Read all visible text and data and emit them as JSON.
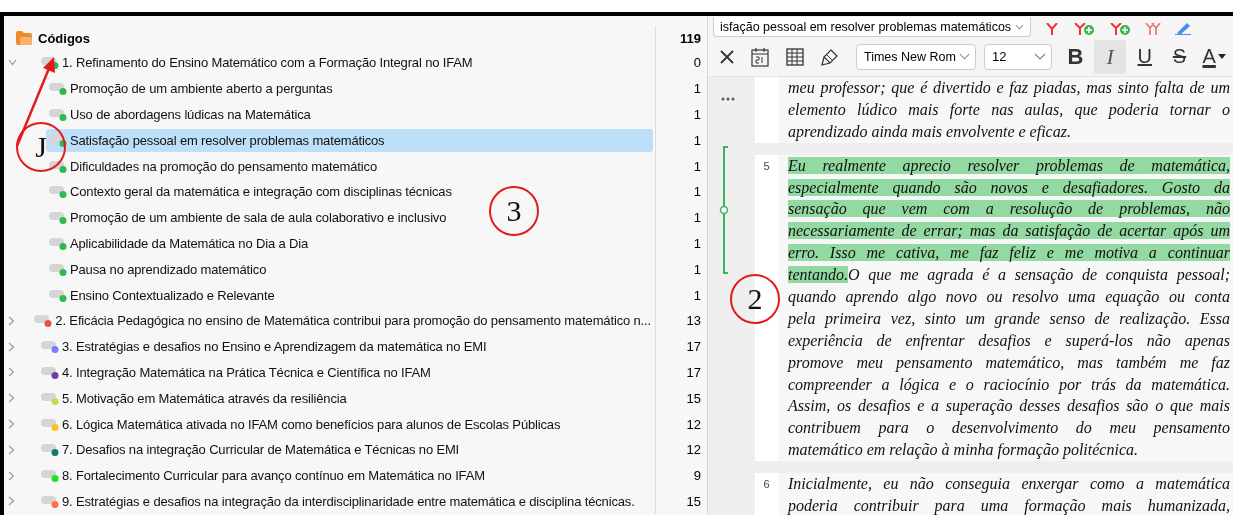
{
  "codes_panel": {
    "root": {
      "label": "Códigos",
      "count": "119"
    },
    "codes": [
      {
        "label": "1. Refinamento do Ensino Matemático com a Formação Integral no IFAM",
        "count": "0",
        "color": "#2eb84f",
        "expanded": true,
        "selected": false,
        "children": [
          {
            "label": "Promoção de um ambiente aberto a perguntas",
            "count": "1",
            "color": "#2eb84f",
            "selected": false
          },
          {
            "label": "Uso de abordagens lúdicas na Matemática",
            "count": "1",
            "color": "#2eb84f",
            "selected": false
          },
          {
            "label": "Satisfação pessoal em resolver problemas matemáticos",
            "count": "1",
            "color": "#2eb84f",
            "selected": true
          },
          {
            "label": "Dificuldades na promoção do pensamento matemático",
            "count": "1",
            "color": "#2eb84f",
            "selected": false
          },
          {
            "label": "Contexto geral da matemática e integração com disciplinas técnicas",
            "count": "1",
            "color": "#2eb84f",
            "selected": false
          },
          {
            "label": "Promoção de um ambiente de sala de aula colaborativo e inclusivo",
            "count": "1",
            "color": "#2eb84f",
            "selected": false
          },
          {
            "label": "Aplicabilidade da Matemática no Dia a Dia",
            "count": "1",
            "color": "#2eb84f",
            "selected": false
          },
          {
            "label": "Pausa no aprendizado matemático",
            "count": "1",
            "color": "#2eb84f",
            "selected": false
          },
          {
            "label": "Ensino Contextualizado e Relevante",
            "count": "1",
            "color": "#2eb84f",
            "selected": false
          }
        ]
      },
      {
        "label": "2. Eficácia Pedagógica no ensino de Matemática contribui para promoção do pensamento matemático n...",
        "count": "13",
        "color": "#e8524a",
        "expanded": false,
        "selected": false
      },
      {
        "label": "3. Estratégias e desafios no Ensino e Aprendizagem da matemática no EMI",
        "count": "17",
        "color": "#7b7bff",
        "expanded": false,
        "selected": false
      },
      {
        "label": "4. Integração Matemática na Prática Técnica e Científica no IFAM",
        "count": "17",
        "color": "#6a3fa8",
        "expanded": false,
        "selected": false
      },
      {
        "label": "5. Motivação em Matemática através da resiliência",
        "count": "15",
        "color": "#c6dc4f",
        "expanded": false,
        "selected": false
      },
      {
        "label": "6. Lógica Matemática ativada no IFAM como benefícios para alunos de Escolas Públicas",
        "count": "12",
        "color": "#ffc21a",
        "expanded": false,
        "selected": false
      },
      {
        "label": "7. Desafios na integração Curricular de Matemática e Técnicas no EMI",
        "count": "12",
        "color": "#0f7a6a",
        "expanded": false,
        "selected": false
      },
      {
        "label": "8. Fortalecimento Curricular para avanço contínuo em Matemática no IFAM",
        "count": "9",
        "color": "#22e022",
        "expanded": false,
        "selected": false
      },
      {
        "label": "9. Estratégias e desafios na integração da interdisciplinaridade entre matemática e disciplina técnicas.",
        "count": "15",
        "color": "#ff7043",
        "expanded": false,
        "selected": false
      }
    ]
  },
  "document_toolbar": {
    "code_dropdown": {
      "value": "isfação pessoal em resolver problemas matemáticos"
    },
    "font_select": {
      "value": "Times New Rom"
    },
    "size_select": {
      "value": "12"
    },
    "format_buttons": [
      {
        "kind": "bold",
        "label": "B",
        "active": false
      },
      {
        "kind": "italic",
        "label": "I",
        "active": true
      },
      {
        "kind": "underline",
        "label": "U",
        "active": false
      },
      {
        "kind": "strike",
        "label": "S",
        "active": false
      },
      {
        "kind": "color",
        "label": "A",
        "active": false
      }
    ]
  },
  "document": {
    "paragraphs": [
      {
        "lines": [
          [
            {
              "text": "meu professor; que é divertido e faz piadas, mas sinto falta de um",
              "coded": false
            }
          ],
          [
            {
              "text": "elemento lúdico mais forte nas aulas, que poderia tornar o",
              "coded": false
            }
          ],
          [
            {
              "text": "aprendizado ainda mais envolvente e eficaz.",
              "coded": false
            }
          ]
        ]
      },
      {
        "number": "5",
        "lines": [
          [
            {
              "text": "Eu realmente aprecio resolver problemas de matemática,",
              "coded": true
            }
          ],
          [
            {
              "text": "especialmente quando são novos e desafiadores. Gosto da",
              "coded": true
            }
          ],
          [
            {
              "text": "sensação que vem com a resolução de problemas, não",
              "coded": true
            }
          ],
          [
            {
              "text": "necessariamente de errar; mas da satisfação de acertar após um",
              "coded": true
            }
          ],
          [
            {
              "text": "erro. Isso me cativa, me faz feliz e me motiva a continuar",
              "coded": true
            }
          ],
          [
            {
              "text": "tentando.",
              "coded": true
            },
            {
              "text": "O que me agrada é a sensação de conquista pessoal;",
              "coded": false
            }
          ],
          [
            {
              "text": "quando aprendo algo novo ou resolvo uma equação ou conta",
              "coded": false
            }
          ],
          [
            {
              "text": "pela primeira vez, sinto um grande senso de realização. Essa",
              "coded": false
            }
          ],
          [
            {
              "text": "experiência de enfrentar desafios e superá-los não apenas",
              "coded": false
            }
          ],
          [
            {
              "text": "promove meu pensamento matemático, mas também me faz",
              "coded": false
            }
          ],
          [
            {
              "text": "compreender a lógica e o raciocínio por trás da matemática.",
              "coded": false
            }
          ],
          [
            {
              "text": "Assim, os desafios e a superação desses desafios são o que mais",
              "coded": false
            }
          ],
          [
            {
              "text": "contribuem para o desenvolvimento do meu pensamento",
              "coded": false
            }
          ],
          [
            {
              "text": "matemático em relação à minha formação politécnica.",
              "coded": false
            }
          ]
        ]
      },
      {
        "number": "6",
        "lines": [
          [
            {
              "text": "Inicialmente, eu não conseguia enxergar como a matemática",
              "coded": false
            }
          ],
          [
            {
              "text": "poderia contribuir para uma formação mais humanizada,",
              "coded": false
            }
          ]
        ]
      }
    ]
  },
  "annotations": [
    {
      "label": "J"
    },
    {
      "label": "3"
    },
    {
      "label": "2"
    }
  ]
}
